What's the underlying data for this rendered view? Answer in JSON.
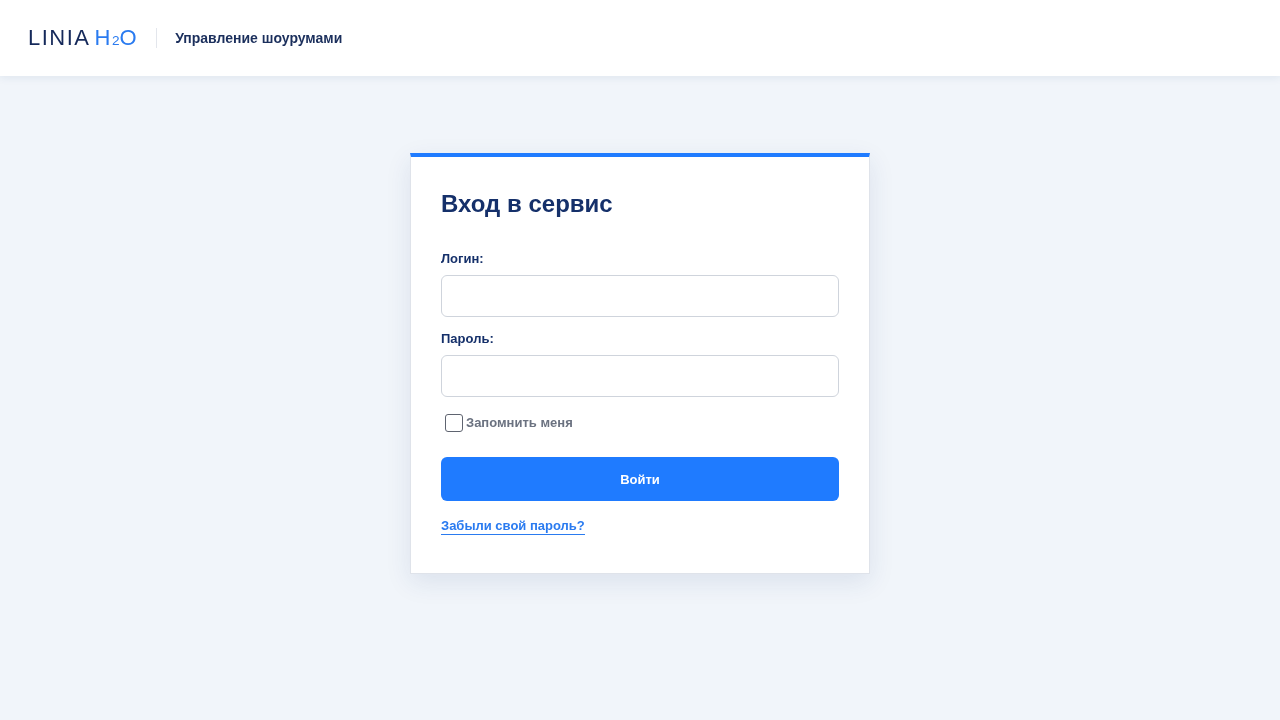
{
  "header": {
    "logo": {
      "text": "LINIA",
      "accent": "H$_{2}$O"
    },
    "title": "Управление шоурумами"
  },
  "login_form": {
    "title": "Вход в сервис",
    "fields": [
      {
        "label": "Логин:"
      },
      {
        "label": "Пароль:"
      }
    ],
    "remember_me": {
      "label": "Запомнить меня",
      "checked": false
    },
    "submit_button": "Войти",
    "forgot_password_link": "Забыли свой пароль?"
  }
}
